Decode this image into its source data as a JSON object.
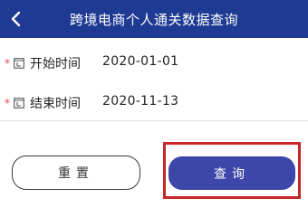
{
  "header": {
    "title": "跨境电商个人通关数据查询"
  },
  "form": {
    "start": {
      "required_mark": "*",
      "label": "开始时间",
      "value": "2020-01-01"
    },
    "end": {
      "required_mark": "*",
      "label": "结束时间",
      "value": "2020-11-13"
    }
  },
  "actions": {
    "reset_label": "重置",
    "query_label": "查询"
  },
  "colors": {
    "header_bg": "#1f3a93",
    "primary_button": "#3d46a9",
    "required": "#d64545",
    "highlight_box": "#c62828"
  },
  "icons": {
    "back": "back-chevron-icon",
    "date": "calendar-icon"
  }
}
